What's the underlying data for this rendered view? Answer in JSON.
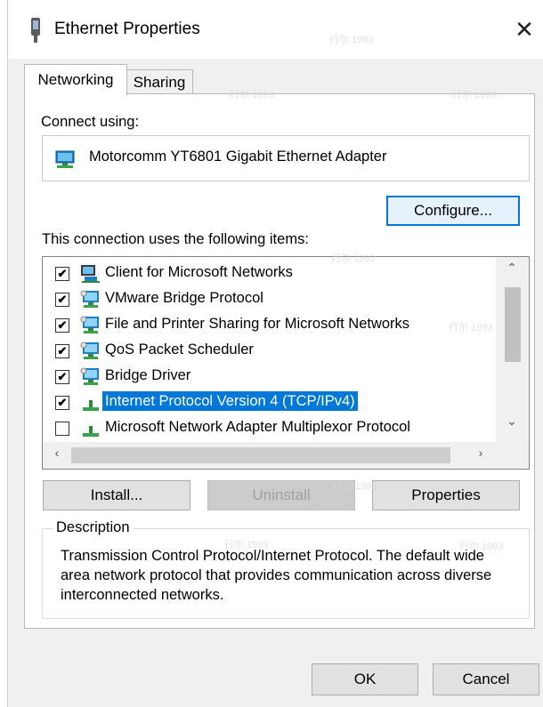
{
  "window": {
    "title": "Ethernet Properties",
    "close_glyph": "✕"
  },
  "tabs": [
    {
      "label": "Networking",
      "active": true
    },
    {
      "label": "Sharing",
      "active": false
    }
  ],
  "connect_using": {
    "label": "Connect using:",
    "adapter": "Motorcomm YT6801 Gigabit Ethernet Adapter",
    "configure_label": "Configure..."
  },
  "items_section": {
    "label": "This connection uses the following items:",
    "items": [
      {
        "label": "Client for Microsoft Networks",
        "checked": true,
        "icon": "network-client-icon"
      },
      {
        "label": "VMware Bridge Protocol",
        "checked": true,
        "icon": "network-service-icon"
      },
      {
        "label": "File and Printer Sharing for Microsoft Networks",
        "checked": true,
        "icon": "network-service-icon"
      },
      {
        "label": "QoS Packet Scheduler",
        "checked": true,
        "icon": "network-service-icon"
      },
      {
        "label": "Bridge Driver",
        "checked": true,
        "icon": "network-service-icon"
      },
      {
        "label": "Internet Protocol Version 4 (TCP/IPv4)",
        "checked": true,
        "icon": "protocol-icon",
        "selected": true
      },
      {
        "label": "Microsoft Network Adapter Multiplexor Protocol",
        "checked": false,
        "icon": "protocol-icon"
      }
    ]
  },
  "buttons": {
    "install": "Install...",
    "uninstall": "Uninstall",
    "properties": "Properties",
    "ok": "OK",
    "cancel": "Cancel"
  },
  "description": {
    "legend": "Description",
    "text": "Transmission Control Protocol/Internet Protocol. The default wide area network protocol that provides communication across diverse interconnected networks."
  },
  "colors": {
    "selection": "#0078d7",
    "focus_border": "#0078d7",
    "dialog_bg": "#f0f0f0"
  },
  "watermark": "行尔 1993"
}
